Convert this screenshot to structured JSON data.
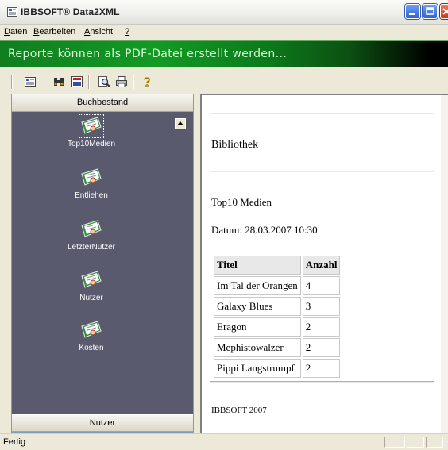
{
  "window": {
    "title": "IBBSOFT® Data2XML"
  },
  "menu": {
    "items": [
      {
        "accel": "D",
        "rest": "aten"
      },
      {
        "accel": "B",
        "rest": "earbeiten"
      },
      {
        "accel": "A",
        "rest": "nsicht"
      },
      {
        "accel": "?",
        "rest": ""
      }
    ]
  },
  "banner": {
    "text": "Reporte können als PDF-Datei erstellt werden..."
  },
  "toolbar": {
    "icons": [
      "app-icon",
      "binoculars-icon",
      "report-icon",
      "zoom-icon",
      "print-icon",
      "help-icon"
    ]
  },
  "nav": {
    "header_top": "Buchbestand",
    "header_bottom": "Nutzer",
    "items": [
      {
        "label": "Top10Medien",
        "icon": "report-book-icon",
        "selected": true
      },
      {
        "label": "Entliehen",
        "icon": "report-book-icon",
        "selected": false
      },
      {
        "label": "LetzterNutzer",
        "icon": "report-book-icon",
        "selected": false
      },
      {
        "label": "Nutzer",
        "icon": "report-book-icon",
        "selected": false
      },
      {
        "label": "Kosten",
        "icon": "report-book-icon",
        "selected": false
      }
    ]
  },
  "report": {
    "title": "Bibliothek",
    "subtitle": "Top10 Medien",
    "date": "Datum: 28.03.2007 10:30",
    "table": {
      "headers": [
        "Titel",
        "Anzahl"
      ],
      "rows": [
        [
          "Im Tal der Orangen",
          "4"
        ],
        [
          "Galaxy Blues",
          "3"
        ],
        [
          "Eragon",
          "2"
        ],
        [
          "Mephistowalzer",
          "2"
        ],
        [
          "Pippi Langstrumpf",
          "2"
        ]
      ]
    },
    "footer": "IBBSOFT 2007"
  },
  "status": {
    "text": "Fertig"
  },
  "colors": {
    "banner_green": "#139a25",
    "nav_bg": "#5a5a6e",
    "titlebar_button": "#2f62d8"
  }
}
